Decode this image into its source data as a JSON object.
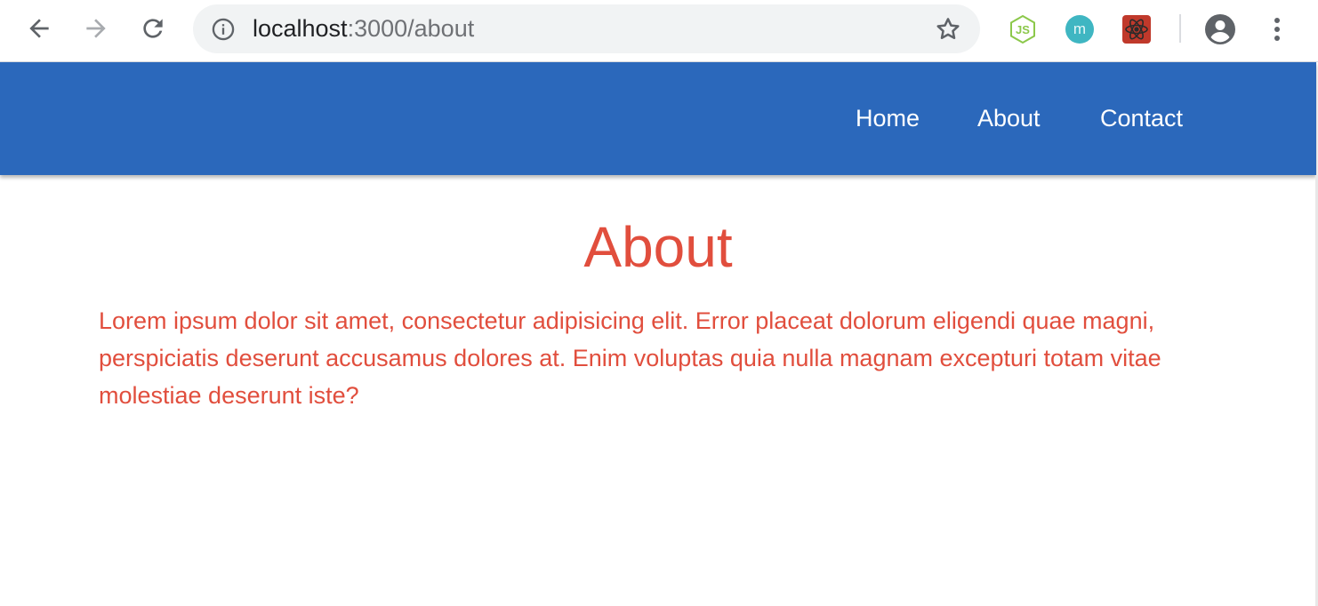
{
  "browser": {
    "url_host": "localhost",
    "url_path": ":3000/about",
    "icons": {
      "back": "arrow-left-icon",
      "forward": "arrow-right-icon",
      "reload": "reload-icon",
      "info": "info-icon",
      "bookmark": "star-icon",
      "menu": "kebab-menu-icon",
      "profile": "account-icon"
    },
    "extensions": [
      {
        "name": "nodejs-extension",
        "label": "JS",
        "color": "#8cc84b"
      },
      {
        "name": "m-extension",
        "label": "m",
        "color": "#3fb6c2"
      },
      {
        "name": "react-extension",
        "label": "react",
        "color": "#c0392b"
      }
    ]
  },
  "navbar": {
    "background": "#2b68bb",
    "links": [
      {
        "label": "Home"
      },
      {
        "label": "About"
      },
      {
        "label": "Contact"
      }
    ]
  },
  "main": {
    "title": "About",
    "text": "Lorem ipsum dolor sit amet, consectetur adipisicing elit. Error placeat dolorum eligendi quae magni, perspiciatis deserunt accusamus dolores at. Enim voluptas quia nulla magnam excepturi totam vitae molestiae deserunt iste?",
    "text_color": "#e14e3d"
  }
}
